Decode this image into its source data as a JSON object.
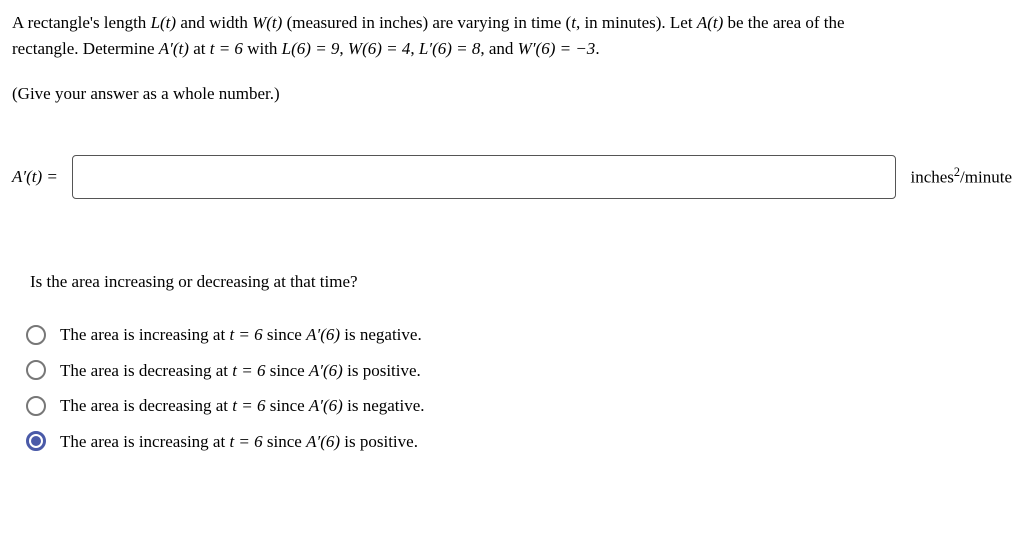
{
  "problem": {
    "line1_pre": "A rectangle's length ",
    "L_of_t": "L(t)",
    "line1_mid1": " and width ",
    "W_of_t": "W(t)",
    "line1_mid2": " (measured in inches) are varying in time (",
    "t": "t",
    "line1_mid3": ", in minutes). Let ",
    "A_of_t": "A(t)",
    "line1_post": " be the area of the",
    "line2_pre": "rectangle. Determine ",
    "Ap_of_t": "A′(t)",
    "line2_mid1": " at ",
    "eq_t": "t = 6",
    "line2_mid2": " with ",
    "eq_L": "L(6) = 9",
    "sep": ", ",
    "eq_W": "W(6) = 4",
    "eq_Lp": "L′(6) = 8",
    "line2_mid3": ", and ",
    "eq_Wp": "W′(6) = −3",
    "period": "."
  },
  "instruction": "(Give your answer as a whole number.)",
  "answer": {
    "label_var": "A′(t)",
    "label_eq": " = ",
    "value": "",
    "unit_base": "inches",
    "unit_exp": "2",
    "unit_per": "/minute"
  },
  "subq": "Is the area increasing or decreasing at that time?",
  "options": [
    {
      "pre": "The area is increasing at ",
      "t_eq": "t = 6",
      "mid": " since ",
      "ap": "A′(6)",
      "post": " is negative.",
      "selected": false
    },
    {
      "pre": "The area is decreasing at ",
      "t_eq": "t = 6",
      "mid": " since ",
      "ap": "A′(6)",
      "post": " is positive.",
      "selected": false
    },
    {
      "pre": "The area is decreasing at ",
      "t_eq": "t = 6",
      "mid": " since ",
      "ap": "A′(6)",
      "post": " is negative.",
      "selected": false
    },
    {
      "pre": "The area is increasing at ",
      "t_eq": "t = 6",
      "mid": " since ",
      "ap": "A′(6)",
      "post": " is positive.",
      "selected": true
    }
  ]
}
